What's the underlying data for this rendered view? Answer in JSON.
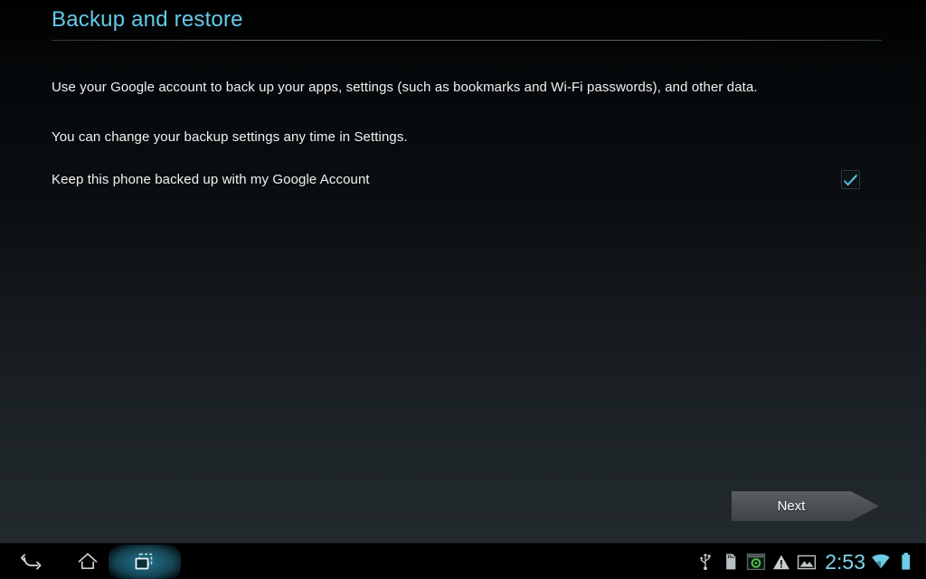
{
  "screen": {
    "title": "Backup and restore",
    "accent_color": "#66c9e8",
    "background_top": "#000000",
    "background_bottom": "#232a2e",
    "text_color": "#f1f1f1"
  },
  "content": {
    "paragraph_1": "Use your Google account to back up your apps, settings (such as bookmarks and Wi-Fi passwords), and other data.",
    "paragraph_2": "You can change your backup settings any time in Settings.",
    "checkbox_label": "Keep this phone backed up with my Google Account",
    "checkbox_checked": true,
    "checkbox_check_color": "#4fc3e8"
  },
  "footer": {
    "next_label": "Next",
    "next_button_color": "#4c5156"
  },
  "navbar": {
    "back_icon": "back-arrow-icon",
    "home_icon": "home-icon",
    "recents_icon": "recent-apps-icon",
    "recents_highlighted": true,
    "highlight_color": "#267a94"
  },
  "statusbar": {
    "time": "2:53",
    "time_color": "#7fd4ea",
    "icons": [
      "usb-icon",
      "sd-card-icon",
      "sync-app-icon",
      "warning-icon",
      "screenshot-icon",
      "wifi-icon",
      "battery-icon"
    ]
  }
}
